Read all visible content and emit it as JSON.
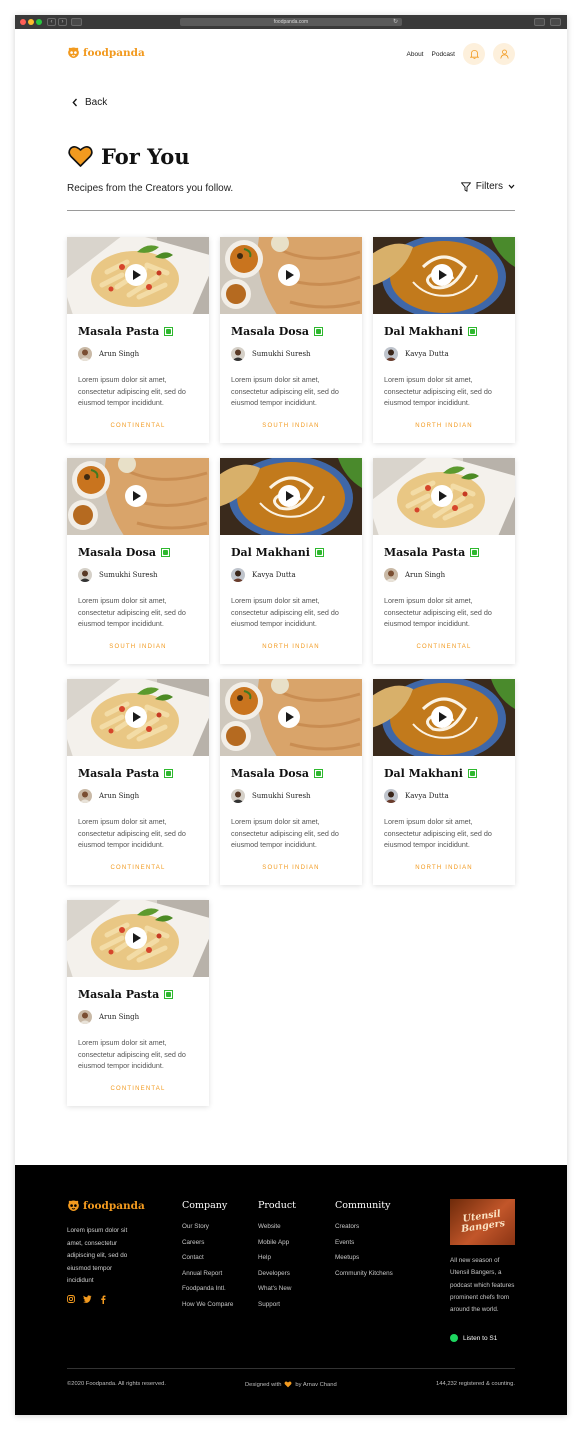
{
  "browser": {
    "url": "foodpanda.com"
  },
  "header": {
    "brand": "foodpanda",
    "nav": [
      {
        "label": "About"
      },
      {
        "label": "Podcast"
      }
    ]
  },
  "page": {
    "back_label": "Back",
    "title": "For You",
    "subtitle": "Recipes from the Creators you follow.",
    "filters_label": "Filters"
  },
  "colors": {
    "accent": "#f29a1f",
    "veg": "#2eb82e",
    "footer_bg": "#000000"
  },
  "cards": [
    {
      "title": "Masala Pasta",
      "author": "Arun Singh",
      "desc": "Lorem ipsum dolor sit amet, consectetur adipiscing elit, sed do eiusmod tempor incididunt.",
      "cuisine": "CONTINENTAL",
      "image": "pasta"
    },
    {
      "title": "Masala Dosa",
      "author": "Sumukhi Suresh",
      "desc": "Lorem ipsum dolor sit amet, consectetur adipiscing elit, sed do eiusmod tempor incididunt.",
      "cuisine": "SOUTH INDIAN",
      "image": "dosa"
    },
    {
      "title": "Dal Makhani",
      "author": "Kavya Dutta",
      "desc": "Lorem ipsum dolor sit amet, consectetur adipiscing elit, sed do eiusmod tempor incididunt.",
      "cuisine": "NORTH INDIAN",
      "image": "dal"
    },
    {
      "title": "Masala Dosa",
      "author": "Sumukhi Suresh",
      "desc": "Lorem ipsum dolor sit amet, consectetur adipiscing elit, sed do eiusmod tempor incididunt.",
      "cuisine": "SOUTH INDIAN",
      "image": "dosa"
    },
    {
      "title": "Dal Makhani",
      "author": "Kavya Dutta",
      "desc": "Lorem ipsum dolor sit amet, consectetur adipiscing elit, sed do eiusmod tempor incididunt.",
      "cuisine": "NORTH INDIAN",
      "image": "dal"
    },
    {
      "title": "Masala Pasta",
      "author": "Arun Singh",
      "desc": "Lorem ipsum dolor sit amet, consectetur adipiscing elit, sed do eiusmod tempor incididunt.",
      "cuisine": "CONTINENTAL",
      "image": "pasta"
    },
    {
      "title": "Masala Pasta",
      "author": "Arun Singh",
      "desc": "Lorem ipsum dolor sit amet, consectetur adipiscing elit, sed do eiusmod tempor incididunt.",
      "cuisine": "CONTINENTAL",
      "image": "pasta"
    },
    {
      "title": "Masala Dosa",
      "author": "Sumukhi Suresh",
      "desc": "Lorem ipsum dolor sit amet, consectetur adipiscing elit, sed do eiusmod tempor incididunt.",
      "cuisine": "SOUTH INDIAN",
      "image": "dosa"
    },
    {
      "title": "Dal Makhani",
      "author": "Kavya Dutta",
      "desc": "Lorem ipsum dolor sit amet, consectetur adipiscing elit, sed do eiusmod tempor incididunt.",
      "cuisine": "NORTH INDIAN",
      "image": "dal"
    },
    {
      "title": "Masala Pasta",
      "author": "Arun Singh",
      "desc": "Lorem ipsum dolor sit amet, consectetur adipiscing elit, sed do eiusmod tempor incididunt.",
      "cuisine": "CONTINENTAL",
      "image": "pasta"
    }
  ],
  "footer": {
    "brand": "foodpanda",
    "about": "Lorem ipsum dolor sit amet, consectetur adipiscing elit, sed do eiusmod tempor incididunt",
    "columns": [
      {
        "title": "Company",
        "links": [
          "Our Story",
          "Careers",
          "Contact",
          "Annual Report",
          "Foodpanda Intl.",
          "How We Compare"
        ]
      },
      {
        "title": "Product",
        "links": [
          "Website",
          "Mobile App",
          "Help",
          "Developers",
          "What's New",
          "Support"
        ]
      },
      {
        "title": "Community",
        "links": [
          "Creators",
          "Events",
          "Meetups",
          "Community Kitchens"
        ]
      }
    ],
    "podcast": {
      "art_title": "Utensil Bangers",
      "desc": "All new season of Utensil Bangers, a podcast which features prominent chefs from around the world.",
      "listen_label": "Listen to S1"
    },
    "copyright": "©2020 Foodpanda. All rights reserved.",
    "designed_prefix": "Designed with",
    "designed_suffix": "by Arnav Chand",
    "count": "144,232 registered & counting."
  }
}
